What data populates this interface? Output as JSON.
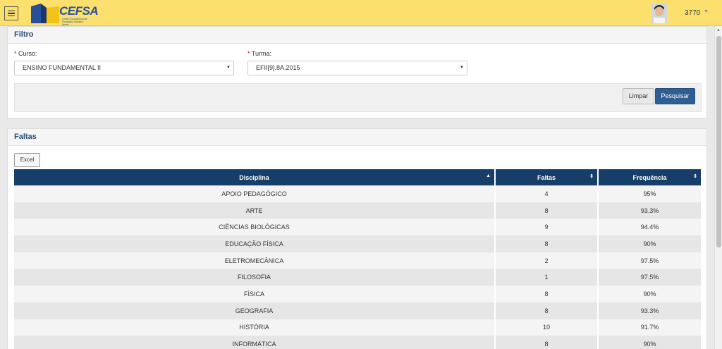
{
  "header": {
    "logo_text": "CEFSA",
    "logo_subtitle": "Centro Educacional da Fundação Salvador Arena",
    "user_id": "3770"
  },
  "filter": {
    "title": "Filtro",
    "curso_label": "Curso:",
    "curso_value": "ENSINO FUNDAMENTAL II",
    "turma_label": "Turma:",
    "turma_value": "EFII[9].8A.2015",
    "required_mark": "*",
    "clear_label": "Limpar",
    "search_label": "Pesquisar"
  },
  "faltas": {
    "title": "Faltas",
    "excel_label": "Excel",
    "columns": [
      "Disciplina",
      "Faltas",
      "Frequência"
    ],
    "rows": [
      {
        "disciplina": "APOIO PEDAGÓGICO",
        "faltas": "4",
        "frequencia": "95%"
      },
      {
        "disciplina": "ARTE",
        "faltas": "8",
        "frequencia": "93.3%"
      },
      {
        "disciplina": "CIÊNCIAS BIOLÓGICAS",
        "faltas": "9",
        "frequencia": "94.4%"
      },
      {
        "disciplina": "EDUCAÇÃO FÍSICA",
        "faltas": "8",
        "frequencia": "90%"
      },
      {
        "disciplina": "ELETROMECÂNICA",
        "faltas": "2",
        "frequencia": "97.5%"
      },
      {
        "disciplina": "FILOSOFIA",
        "faltas": "1",
        "frequencia": "97.5%"
      },
      {
        "disciplina": "FÍSICA",
        "faltas": "8",
        "frequencia": "90%"
      },
      {
        "disciplina": "GEOGRAFIA",
        "faltas": "8",
        "frequencia": "93.3%"
      },
      {
        "disciplina": "HISTÓRIA",
        "faltas": "10",
        "frequencia": "91.7%"
      },
      {
        "disciplina": "INFORMÁTICA",
        "faltas": "8",
        "frequencia": "90%"
      }
    ]
  },
  "colors": {
    "topbar": "#fbe06e",
    "table_header": "#163e68",
    "primary_button": "#2f5e95",
    "panel_title": "#2b4b74"
  },
  "icons": {
    "menu": "hamburger-menu-icon",
    "sort": "sort-icon",
    "dropdown": "chevron-down-icon"
  }
}
